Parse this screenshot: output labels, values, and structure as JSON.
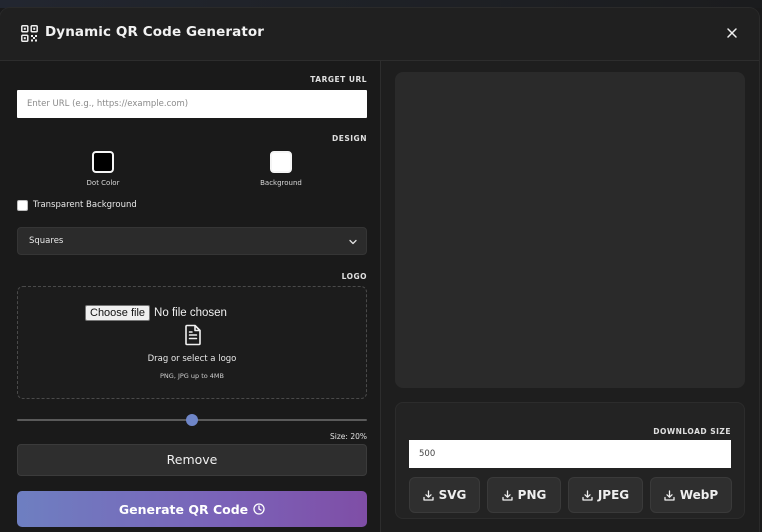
{
  "header": {
    "title": "Dynamic QR Code Generator",
    "logo_icon": "qr-code-icon",
    "close_icon": "close-icon"
  },
  "target_url": {
    "label": "TARGET URL",
    "value": "",
    "placeholder": "Enter URL (e.g., https://example.com)"
  },
  "design": {
    "label": "DESIGN",
    "dot_color": {
      "label": "Dot Color",
      "color": "#000000"
    },
    "background": {
      "label": "Background",
      "color": "#ffffff"
    },
    "transparent": {
      "label": "Transparent Background",
      "checked": false
    },
    "style_select": {
      "selected": "Squares"
    }
  },
  "logo": {
    "label": "LOGO",
    "choose_file_label": "Choose file",
    "no_file_text": "No file chosen",
    "drop_text": "Drag or select a logo",
    "hint_text": "PNG, JPG up to 4MB",
    "size_percent": 20,
    "size_label": "Size: 20%",
    "remove_label": "Remove"
  },
  "generate": {
    "label": "Generate QR Code",
    "icon": "clock-icon",
    "gradient": [
      "#6e7fc1",
      "#7f4ea6"
    ]
  },
  "download": {
    "label": "DOWNLOAD SIZE",
    "size_value": "500",
    "formats": [
      {
        "label": "SVG"
      },
      {
        "label": "PNG"
      },
      {
        "label": "JPEG"
      },
      {
        "label": "WebP"
      }
    ]
  },
  "colors": {
    "accent": "#6f86c8",
    "panel_bg": "#2a2a2a"
  }
}
